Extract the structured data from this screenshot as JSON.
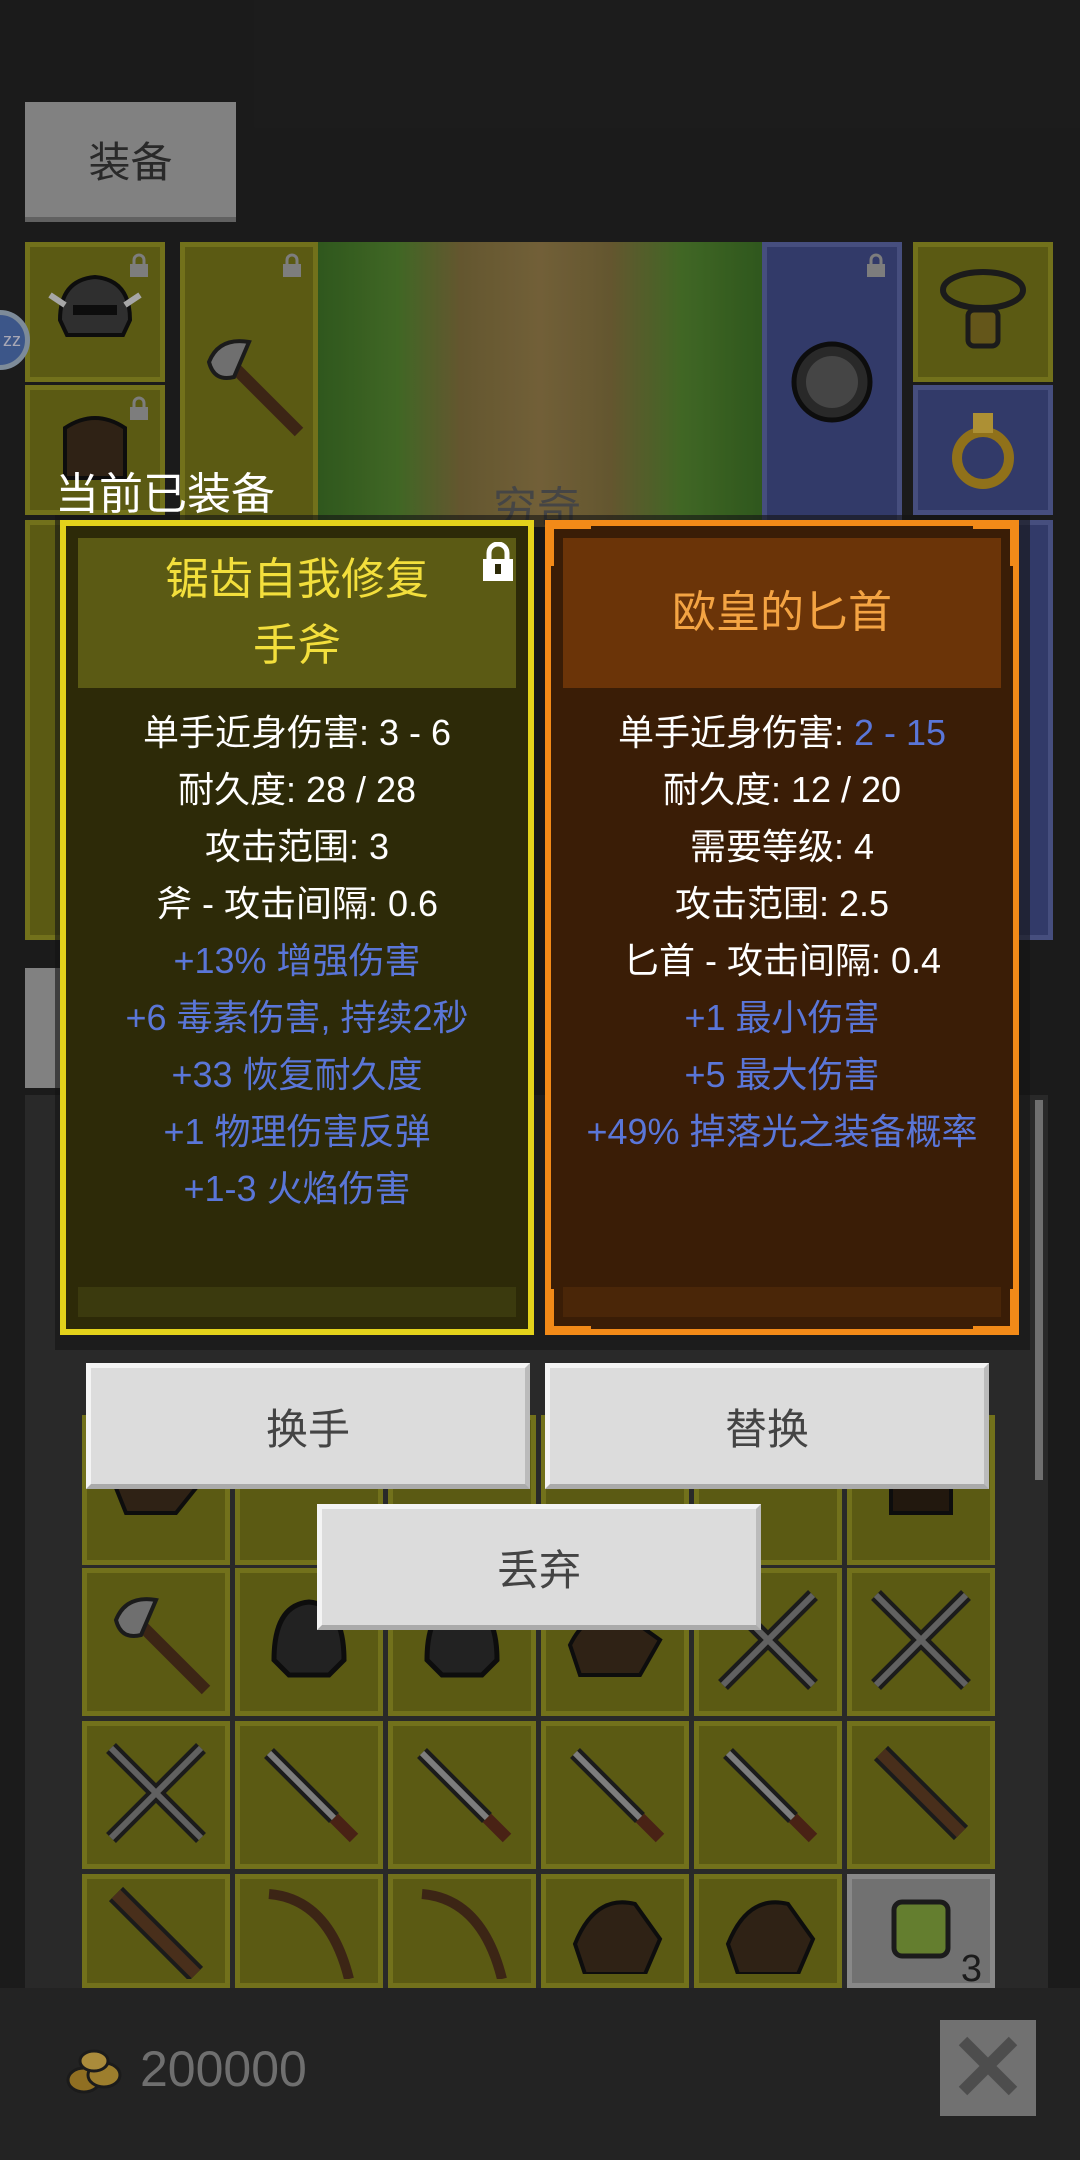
{
  "header": {
    "tab_label": "装备"
  },
  "scene": {
    "text": "穷奇"
  },
  "current_equipped_label": "当前已装备",
  "equipped_item": {
    "name_line1": "锯齿自我修复",
    "name_line2": "手斧",
    "locked": true,
    "stats": [
      {
        "text": "单手近身伤害: 3 - 6",
        "color": "white"
      },
      {
        "text": "耐久度: 28 / 28",
        "color": "white"
      },
      {
        "text": "攻击范围: 3",
        "color": "white"
      },
      {
        "text": "斧 - 攻击间隔: 0.6",
        "color": "white"
      },
      {
        "text": "+13% 增强伤害",
        "color": "blue"
      },
      {
        "text": "+6 毒素伤害, 持续2秒",
        "color": "blue"
      },
      {
        "text": "+33 恢复耐久度",
        "color": "blue"
      },
      {
        "text": "+1 物理伤害反弹",
        "color": "blue"
      },
      {
        "text": "+1-3 火焰伤害",
        "color": "blue"
      }
    ]
  },
  "new_item": {
    "name": "欧皇的匕首",
    "damage_label": "单手近身伤害: ",
    "damage_value": "2 - 15",
    "stats": [
      {
        "text": "耐久度: 12 / 20",
        "color": "white"
      },
      {
        "text": "需要等级: 4",
        "color": "white"
      },
      {
        "text": "攻击范围: 2.5",
        "color": "white"
      },
      {
        "text": "匕首 - 攻击间隔: 0.4",
        "color": "white"
      },
      {
        "text": "+1 最小伤害",
        "color": "blue"
      },
      {
        "text": "+5 最大伤害",
        "color": "blue"
      },
      {
        "text": "+49% 掉落光之装备概率",
        "color": "blue"
      }
    ]
  },
  "actions": {
    "swap_hand": "换手",
    "replace": "替换",
    "discard": "丢弃"
  },
  "inventory": {
    "stack_count": "3"
  },
  "footer": {
    "gold": "200000"
  },
  "colors": {
    "stat_blue": "#5a76d8",
    "legendary_orange": "#f28a18",
    "equipped_yellow": "#e3d21b"
  }
}
